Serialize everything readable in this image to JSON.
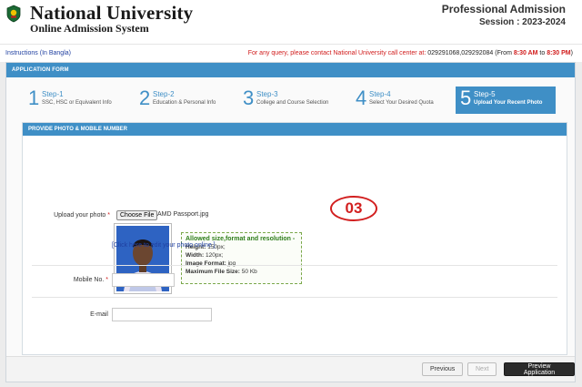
{
  "header": {
    "university": "National University",
    "subtitle": "Online Admission System",
    "program": "Professional Admission",
    "session": "Session : 2023-2024"
  },
  "infobar": {
    "instructions": "Instructions (In Bangla)",
    "query_prefix": "For any query, please contact National University call center at: ",
    "phones": "029291068,029292084",
    "from_word": " (From ",
    "time_start": "8:30 AM",
    "to_word": " to ",
    "time_end": "8:30 PM",
    "close_paren": ")"
  },
  "form": {
    "title": "APPLICATION FORM",
    "steps": [
      {
        "num": "1",
        "title": "Step-1",
        "desc": "SSC, HSC or Equivalent Info",
        "active": false
      },
      {
        "num": "2",
        "title": "Step-2",
        "desc": "Education & Personal Info",
        "active": false
      },
      {
        "num": "3",
        "title": "Step-3",
        "desc": "College and Course Selection",
        "active": false
      },
      {
        "num": "4",
        "title": "Step-4",
        "desc": "Select Your Desired Quota",
        "active": false
      },
      {
        "num": "5",
        "title": "Step-5",
        "desc": "Upload Your Recent Photo",
        "active": true
      }
    ],
    "section_title": "PROVIDE PHOTO & MOBILE NUMBER",
    "upload_label": "Upload your photo",
    "required_mark": "*",
    "choose_file": "Choose File",
    "file_name": "AMD Passport.jpg",
    "note": {
      "heading": "Allowed size,format and resolution -",
      "height_label": "Height:",
      "height_value": "150px;",
      "width_label": "Width:",
      "width_value": "120px;",
      "format_label": "Image Format:",
      "format_value": "jpg",
      "size_label": "Maximum File Size:",
      "size_value": "50 Kb"
    },
    "badge": "03",
    "edit_link": "[Click here to edit your photo online ]",
    "mobile_label": "Mobile No.",
    "mobile_value": "",
    "email_label": "E-mail",
    "email_value": ""
  },
  "buttons": {
    "previous": "Previous",
    "next": "Next",
    "preview": "Preview Application"
  },
  "colors": {
    "accent": "#3f8fc6",
    "alert": "#d11c1c",
    "primary_button": "#2b2b2b"
  }
}
